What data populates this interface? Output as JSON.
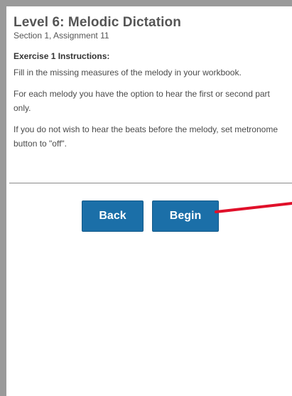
{
  "header": {
    "title": "Level 6: Melodic Dictation",
    "subtitle": "Section 1, Assignment 11"
  },
  "instructions": {
    "heading": "Exercise 1 Instructions:",
    "paragraphs": [
      "Fill in the missing measures of the melody in your workbook.",
      "For each melody you have the option to hear the first or second part only.",
      "If you do not wish to hear the beats before the melody, set metronome button to \"off\"."
    ]
  },
  "actions": {
    "back_label": "Back",
    "begin_label": "Begin"
  },
  "colors": {
    "button": "#1b6fa8",
    "annotation_arrow": "#e0102a",
    "frame": "#9a9a9a"
  },
  "icons": {
    "annotation": "red-arrow-icon"
  }
}
